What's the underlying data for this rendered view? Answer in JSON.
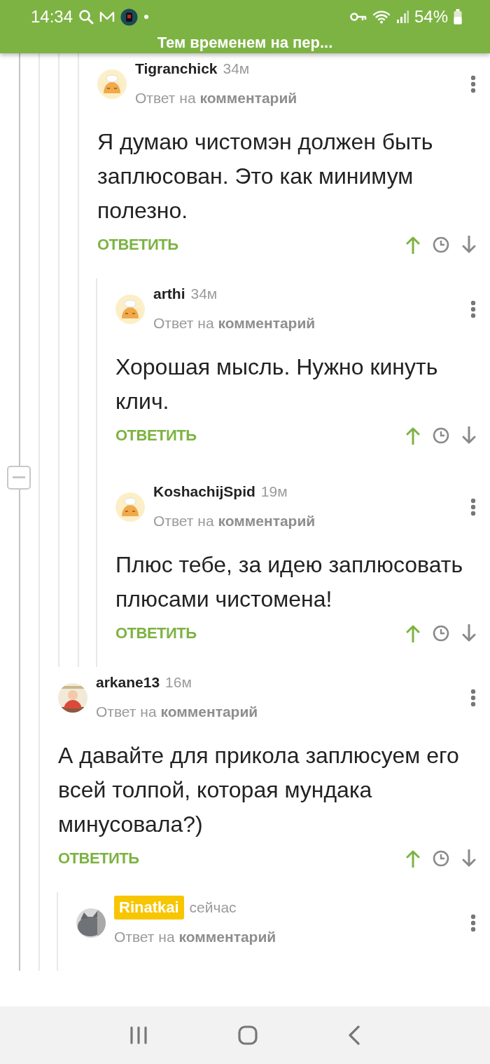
{
  "status_bar": {
    "time": "14:34",
    "battery": "54%"
  },
  "header": {
    "title": "Тем временем на пер..."
  },
  "thread_above": [
    {
      "author": "Tigranchick",
      "time": "34м",
      "own": false,
      "avatar": {
        "kind": "default"
      },
      "reply_prefix": "Ответ на",
      "reply_target": "комментарий",
      "text": "Я думаю чистомэн должен быть заплюсован. Это как минимум полезно.",
      "reply_label": "ОТВЕТИТЬ",
      "children": [
        {
          "author": "arthi",
          "time": "34м",
          "own": false,
          "avatar": {
            "kind": "default"
          },
          "reply_prefix": "Ответ на",
          "reply_target": "комментарий",
          "text": "Хорошая мысль. Нужно кинуть клич.",
          "reply_label": "ОТВЕТИТЬ"
        },
        {
          "author": "KoshachijSpid",
          "time": "19м",
          "own": false,
          "avatar": {
            "kind": "default"
          },
          "reply_prefix": "Ответ на",
          "reply_target": "комментарий",
          "text": "Плюс тебе, за идею заплюсовать плюсами чистомена!",
          "reply_label": "ОТВЕТИТЬ"
        }
      ]
    }
  ],
  "comments": [
    {
      "author": "arkane13",
      "time": "16м",
      "own": false,
      "avatar": {
        "kind": "picture"
      },
      "reply_prefix": "Ответ на",
      "reply_target": "комментарий",
      "text": "А давайте для прикола заплюсуем его всей толпой, которая мундака минусовала?)",
      "reply_label": "ОТВЕТИТЬ",
      "children": [
        {
          "author": "Rinatkai",
          "time": "сейчас",
          "own": true,
          "avatar": {
            "kind": "picture"
          },
          "reply_prefix": "Ответ на",
          "reply_target": "комментарий"
        }
      ]
    }
  ]
}
